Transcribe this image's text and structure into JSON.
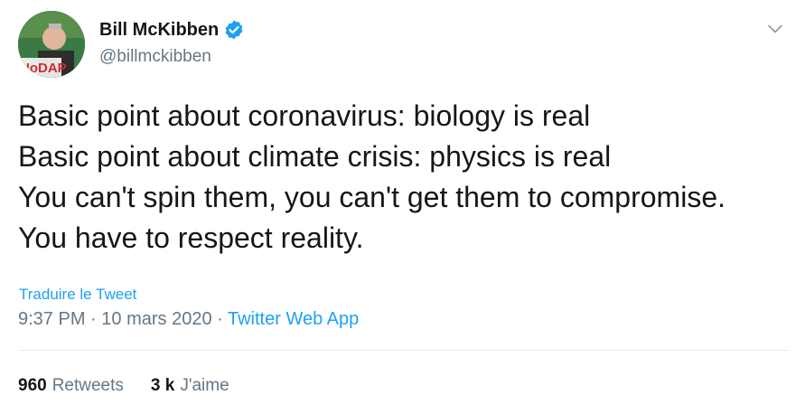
{
  "author": {
    "display_name": "Bill McKibben",
    "handle": "@billmckibben",
    "avatar_text": "NoDAP",
    "verified_icon": "verified-badge-icon"
  },
  "tweet": {
    "lines": [
      "Basic point about coronavirus: biology is real",
      "Basic point about climate crisis: physics is real",
      "You can't spin them, you can't get them to compromise.",
      "You have to respect reality."
    ],
    "translate_label": "Traduire le Tweet",
    "time": "9:37 PM",
    "date": "10 mars 2020",
    "separator": "·",
    "app": "Twitter Web App"
  },
  "stats": {
    "retweets_count": "960",
    "retweets_label": "Retweets",
    "likes_count": "3 k",
    "likes_label": "J'aime"
  },
  "colors": {
    "accent": "#1da1f2",
    "text": "#14171a",
    "muted": "#657786",
    "divider": "#e6ecf0"
  }
}
